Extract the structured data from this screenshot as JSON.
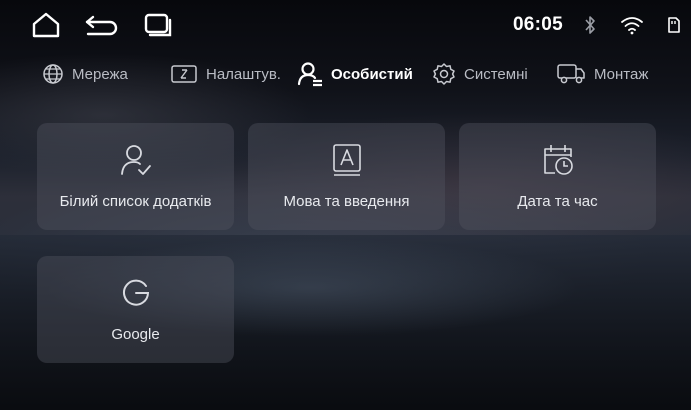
{
  "statusbar": {
    "time": "06:05",
    "icons": [
      "home-icon",
      "back-icon",
      "recent-apps-icon",
      "bluetooth-icon",
      "wifi-icon",
      "sd-card-icon"
    ]
  },
  "tabs": [
    {
      "label": "Мережа",
      "icon": "globe-icon",
      "active": false
    },
    {
      "label": "Налаштув.",
      "icon": "settings-card-icon",
      "active": false
    },
    {
      "label": "Особистий",
      "icon": "person-list-icon",
      "active": true
    },
    {
      "label": "Системні",
      "icon": "gear-icon",
      "active": false
    },
    {
      "label": "Монтаж",
      "icon": "truck-icon",
      "active": false
    }
  ],
  "tiles": [
    {
      "label": "Білий список додатків",
      "icon": "person-check-icon"
    },
    {
      "label": "Мова та введення",
      "icon": "language-input-icon"
    },
    {
      "label": "Дата та час",
      "icon": "calendar-clock-icon"
    },
    {
      "label": "Google",
      "icon": "google-icon"
    }
  ],
  "colors": {
    "text": "#ffffff",
    "inactive_tab": "#b9bcc4",
    "tile_bg": "#50546099"
  }
}
